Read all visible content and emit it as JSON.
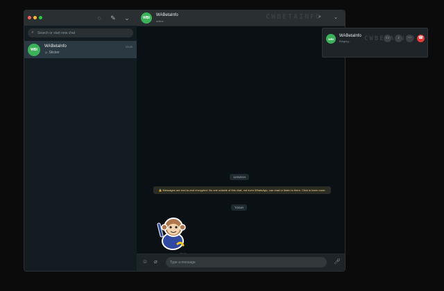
{
  "colors": {
    "traffic_close": "#ff5f57",
    "traffic_minimize": "#febc2e",
    "traffic_maximize": "#28c840",
    "avatar_green": "#3bb15a",
    "decline_red": "#e53935",
    "encryption_notice_text": "#f5d98a"
  },
  "sidebar": {
    "header_icons": [
      "status-icon",
      "new-chat-icon",
      "menu-chevron-icon"
    ],
    "search": {
      "placeholder": "Search or start new chat",
      "icon": "search-icon"
    },
    "chats": [
      {
        "avatar": "WBI",
        "name": "WABetaInfo",
        "preview": "Sticker",
        "preview_icon": "sticker-icon",
        "time": "22:00"
      }
    ]
  },
  "conversation": {
    "contact": {
      "avatar": "WBI",
      "name": "WABetaInfo",
      "status": "online"
    },
    "watermark": "CWBETAINFO",
    "header_icons": [
      "search-icon",
      "menu-chevron-icon"
    ],
    "messages": {
      "date_chip": "12/3/2019",
      "encryption_notice": "🔒 Messages are end-to-end encrypted. No one outside of this chat, not even WhatsApp, can read or listen to them. Click to learn more.",
      "today_chip": "TODAY",
      "sticker": {
        "icon": "monkey-sticker",
        "time": "22:00"
      }
    },
    "composer": {
      "placeholder": "Type a message",
      "icons": [
        "emoji-icon",
        "attach-icon",
        "mic-icon"
      ]
    }
  },
  "call_popup": {
    "avatar": "WBI",
    "name": "WABetaInfo",
    "status": "Ringing...",
    "watermark": "CWBETAINFO",
    "buttons": [
      "video-icon",
      "mic-icon",
      "more-icon",
      "decline-icon"
    ]
  }
}
